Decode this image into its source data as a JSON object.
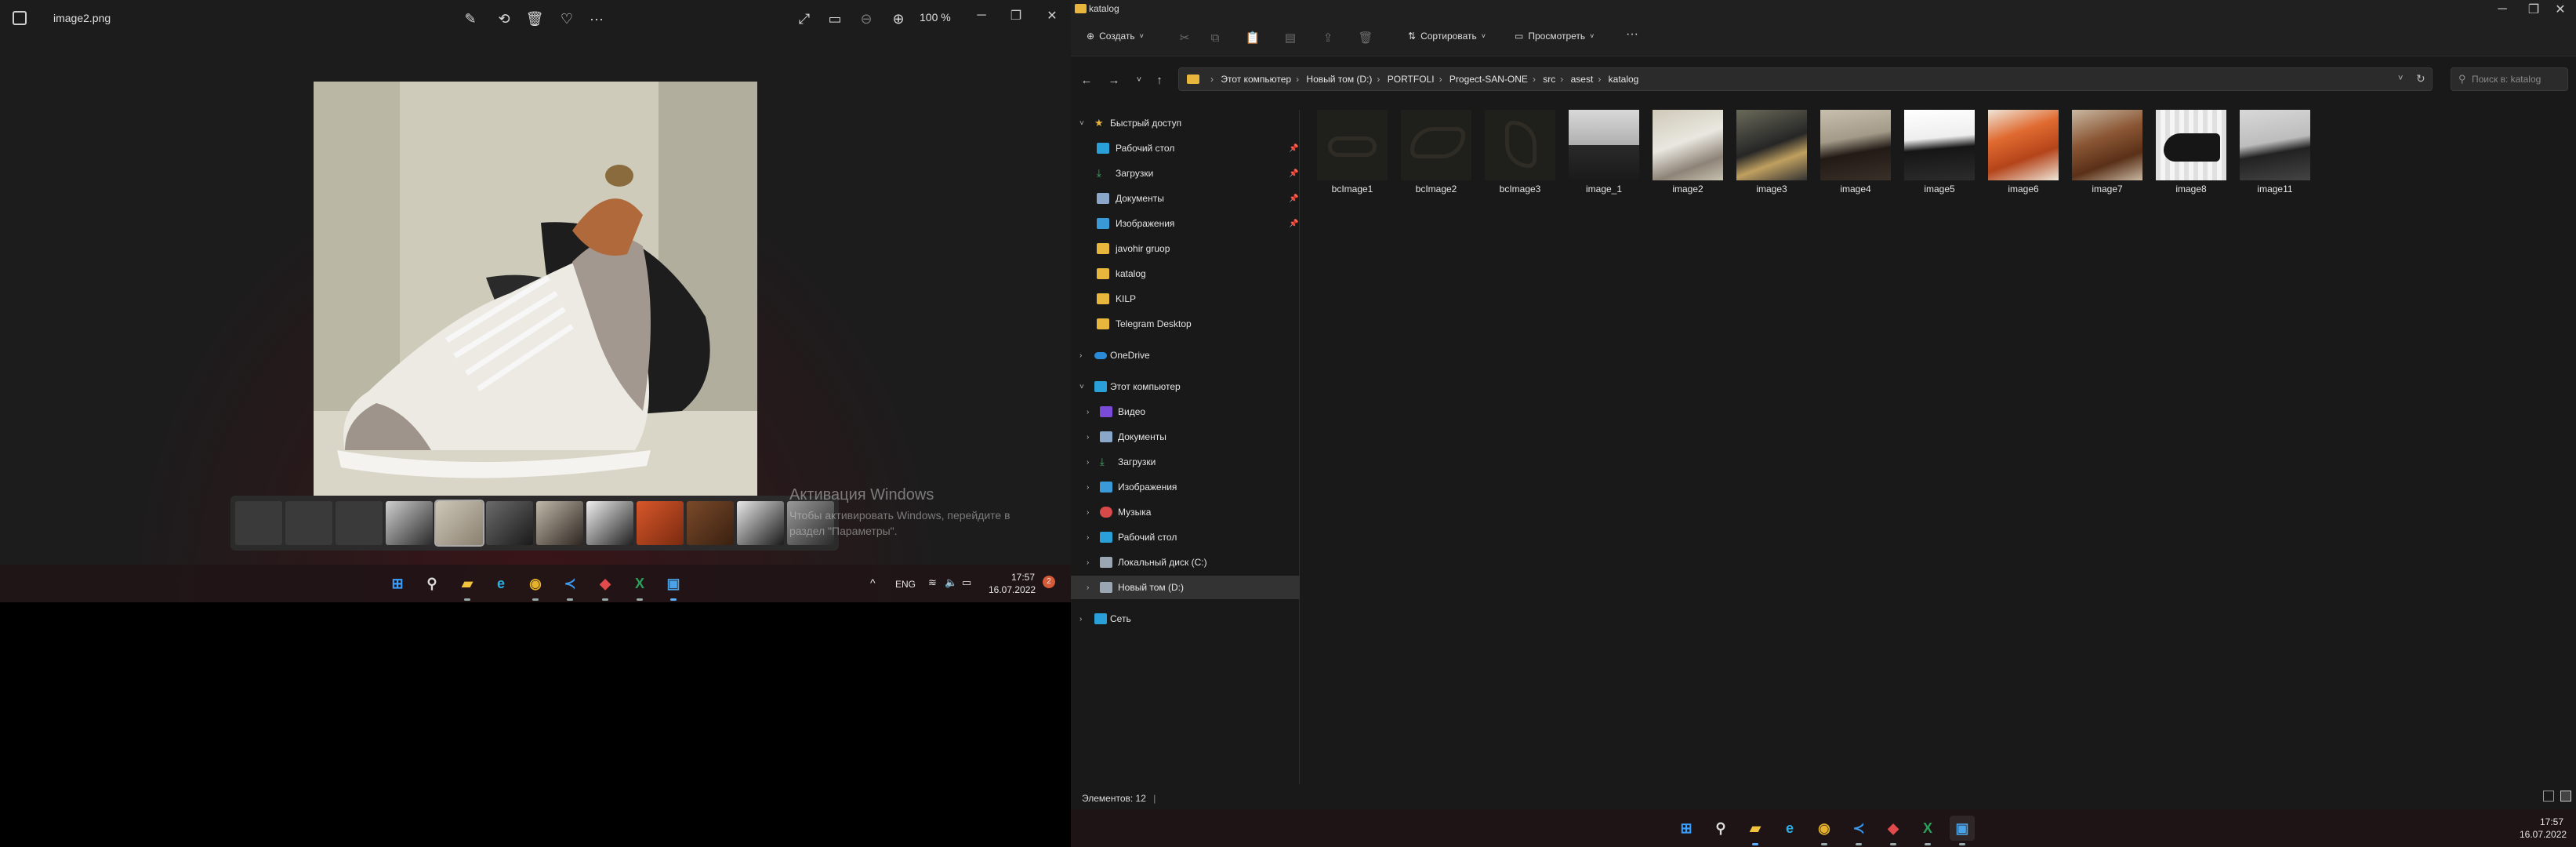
{
  "photos": {
    "title": "image2.png",
    "zoom": "100 %",
    "activation": {
      "line1": "Активация Windows",
      "line2": "Чтобы активировать Windows, перейдите в раздел \"Параметры\"."
    },
    "taskbar": {
      "lang": "ENG",
      "time": "17:57",
      "date": "16.07.2022",
      "notification_count": "2"
    }
  },
  "explorer": {
    "window_title": "katalog",
    "cmd": {
      "create_label": "Создать",
      "sort_label": "Сортировать",
      "view_label": "Просмотреть",
      "more_label": "···"
    },
    "breadcrumb": [
      "Этот компьютер",
      "Новый том (D:)",
      "PORTFOLI",
      "Progect-SAN-ONE",
      "src",
      "asest",
      "katalog"
    ],
    "search_placeholder": "Поиск в: katalog",
    "nav": {
      "quick_access": "Быстрый доступ",
      "quick_items": [
        "Рабочий стол",
        "Загрузки",
        "Документы",
        "Изображения",
        "javohir gruop",
        "katalog",
        "KILP",
        "Telegram Desktop"
      ],
      "onedrive": "OneDrive",
      "this_pc": "Этот компьютер",
      "pc_items": [
        "Видео",
        "Документы",
        "Загрузки",
        "Изображения",
        "Музыка",
        "Рабочий стол",
        "Локальный диск (C:)",
        "Новый том (D:)"
      ],
      "network": "Сеть"
    },
    "files": [
      "bcImage1",
      "bcImage2",
      "bcImage3",
      "image_1",
      "image2",
      "image3",
      "image4",
      "image5",
      "image6",
      "image7",
      "image8",
      "image11"
    ],
    "status": "Элементов: 12",
    "taskbar": {
      "time": "17:57",
      "date": "16.07.2022"
    }
  }
}
